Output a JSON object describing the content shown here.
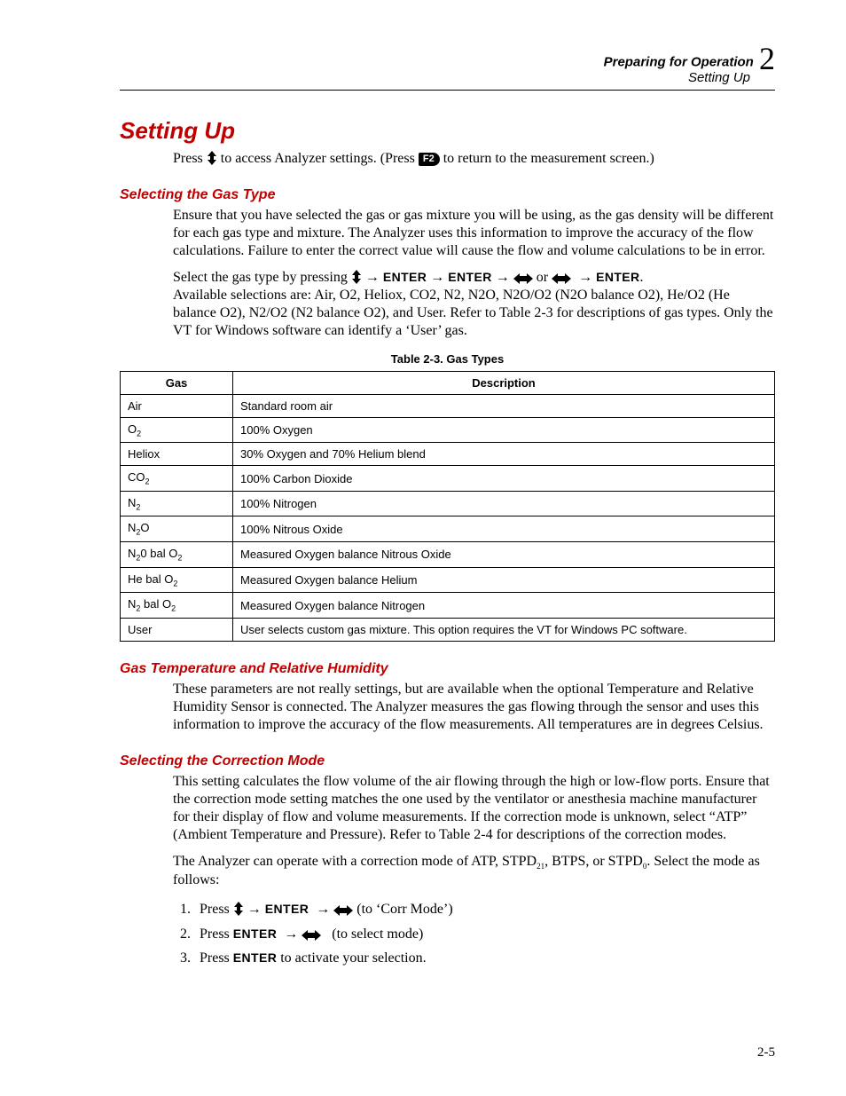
{
  "header": {
    "chapter_title": "Preparing for Operation",
    "section_title": "Setting Up",
    "chapter_number": "2"
  },
  "section": {
    "title": "Setting Up",
    "intro_prefix": "Press ",
    "intro_mid": " to access Analyzer settings. (Press ",
    "intro_badge": "F2",
    "intro_suffix": " to return to the measurement screen.)"
  },
  "gas_type": {
    "heading": "Selecting the Gas Type",
    "p1": "Ensure that you have selected the gas or gas mixture you will be using, as the gas density will be different for each gas type and mixture. The Analyzer uses this information to improve the accuracy of the flow calculations. Failure to enter the correct value will cause the flow and volume calculations to be in error.",
    "p2_prefix": "Select the gas type by pressing ",
    "arrow": "→",
    "enter": "ENTER",
    "or": " or ",
    "period": ".",
    "p2_line2": "Available selections are: Air, O2, Heliox, CO2, N2, N2O, N2O/O2 (N2O balance O2), He/O2 (He balance O2), N2/O2 (N2 balance O2), and User. Refer to Table 2-3 for descriptions of gas types. Only the VT for Windows software can identify a ‘User’ gas."
  },
  "table": {
    "caption": "Table 2-3. Gas Types",
    "head_gas": "Gas",
    "head_desc": "Description",
    "rows": [
      {
        "gas_html": "Air",
        "desc": "Standard room air"
      },
      {
        "gas_html": "O<span class=\"sub\">2</span>",
        "desc": "100% Oxygen"
      },
      {
        "gas_html": "Heliox",
        "desc": "30% Oxygen and 70% Helium blend"
      },
      {
        "gas_html": "CO<span class=\"sub\">2</span>",
        "desc": "100% Carbon Dioxide"
      },
      {
        "gas_html": "N<span class=\"sub\">2</span>",
        "desc": "100% Nitrogen"
      },
      {
        "gas_html": "N<span class=\"sub\">2</span>O",
        "desc": "100% Nitrous Oxide"
      },
      {
        "gas_html": "N<span class=\"sub\">2</span>0 bal O<span class=\"sub\">2</span>",
        "desc": "Measured Oxygen balance Nitrous Oxide"
      },
      {
        "gas_html": "He bal O<span class=\"sub\">2</span>",
        "desc": "Measured Oxygen balance Helium"
      },
      {
        "gas_html": "N<span class=\"sub\">2</span> bal O<span class=\"sub\">2</span>",
        "desc": "Measured Oxygen balance Nitrogen"
      },
      {
        "gas_html": "User",
        "desc": "User selects custom gas mixture. This option requires the VT for Windows PC software."
      }
    ]
  },
  "temp_rh": {
    "heading": "Gas Temperature and Relative Humidity",
    "p1": "These parameters are not really settings, but are available when the optional Temperature and Relative Humidity Sensor is connected. The Analyzer measures the gas flowing through the sensor and uses this information to improve the accuracy of the flow measurements. All temperatures are in degrees Celsius."
  },
  "corr_mode": {
    "heading": "Selecting the Correction Mode",
    "p1": "This setting calculates the flow volume of the air flowing through the high or low-flow ports. Ensure that the correction mode setting matches the one used by the ventilator or anesthesia machine manufacturer for their display of flow and volume measurements. If the correction mode is unknown, select “ATP” (Ambient Temperature and Pressure). Refer to Table 2-4 for descriptions of the correction modes.",
    "p2_prefix": "The Analyzer can operate with a correction mode of ATP, STPD",
    "p2_sub1": "21",
    "p2_mid": ", BTPS, or STPD",
    "p2_sub2": "0",
    "p2_suffix": ". Select the mode as follows:",
    "steps": {
      "s1_prefix": "Press ",
      "s1_suffix": " (to ‘Corr Mode’)",
      "s2_prefix": "Press ",
      "s2_suffix": " (to select mode)",
      "s3_prefix": "Press ",
      "s3_suffix": " to activate your selection."
    }
  },
  "page_number": "2-5"
}
